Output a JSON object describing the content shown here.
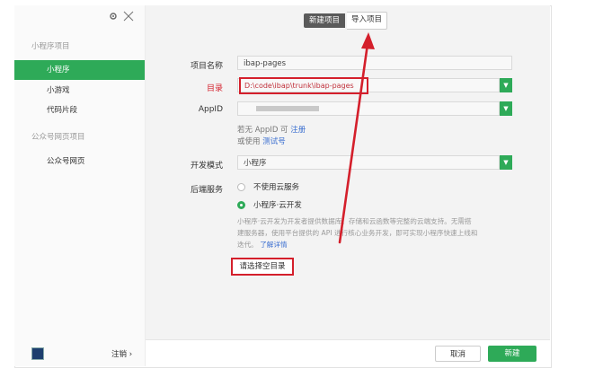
{
  "window": {
    "tabs": {
      "new_project": "新建项目",
      "import_project": "导入项目"
    }
  },
  "sidebar": {
    "sections": [
      {
        "title": "小程序项目",
        "items": [
          "小程序",
          "小游戏",
          "代码片段"
        ]
      },
      {
        "title": "公众号网页项目",
        "items": [
          "公众号网页"
        ]
      }
    ],
    "logout_label": "注销",
    "logout_chevron": "›"
  },
  "form": {
    "project_name_label": "项目名称",
    "project_name_value": "ibap-pages",
    "directory_label": "目录",
    "directory_value": "D:\\code\\ibap\\trunk\\ibap-pages",
    "appid_label": "AppID",
    "appid_hint_prefix": "若无 AppID 可",
    "appid_hint_register": "注册",
    "appid_hint_or": "或使用",
    "appid_hint_test": "测试号",
    "dev_mode_label": "开发模式",
    "dev_mode_value": "小程序",
    "backend_label": "后端服务",
    "backend_options": [
      "不使用云服务",
      "小程序·云开发"
    ],
    "backend_selected": 1,
    "cloud_desc_line1": "小程序·云开发为开发者提供数据库、存储和云函数等完整的云端支持。无需搭",
    "cloud_desc_line2": "建服务器，使用平台提供的 API 进行核心业务开发，即可实现小程序快速上线和",
    "cloud_desc_line3": "迭代。",
    "cloud_desc_link": "了解详情",
    "empty_dir_notice": "请选择空目录"
  },
  "footer": {
    "cancel_label": "取消",
    "create_label": "新建"
  },
  "colors": {
    "accent": "#2eaa58",
    "annotation_red": "#d41f2b",
    "link": "#3b6fd0"
  },
  "icons": {
    "settings": "gear-icon",
    "close": "close-icon",
    "dropdown": "chevron-down-icon"
  }
}
